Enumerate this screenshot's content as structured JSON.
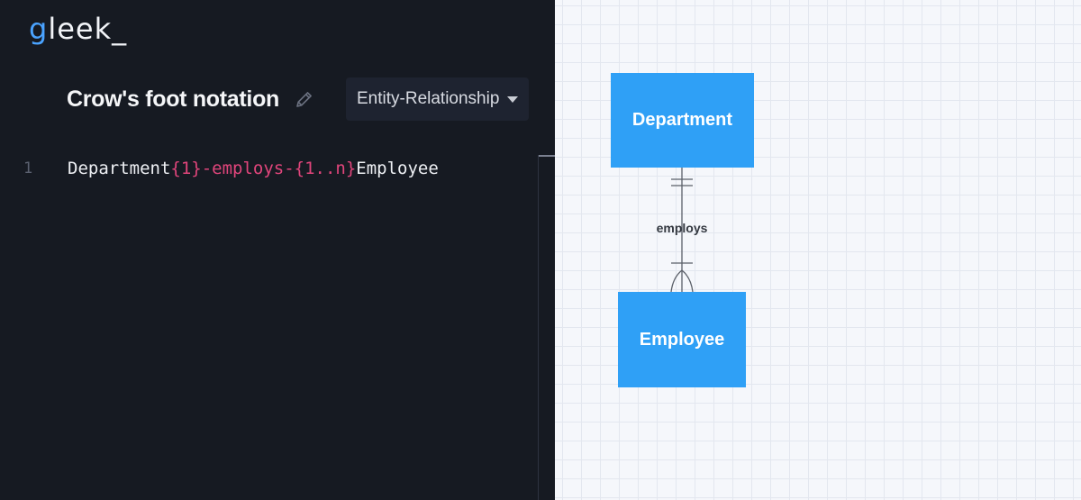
{
  "app": {
    "logo_first": "g",
    "logo_rest": "leek",
    "logo_cursor": "_",
    "logo_color": "#4aa3ff"
  },
  "editor": {
    "title": "Crow's foot notation",
    "edit_icon": "pencil-icon",
    "diagram_type": "Entity-Relationship",
    "dropdown_icon": "caret-down-icon",
    "lines": [
      {
        "number": "1",
        "tokens": {
          "entity_a": "Department",
          "relation": "{1}-employs-{1..n}",
          "entity_b": "Employee"
        }
      }
    ],
    "colors": {
      "background": "#161a22",
      "relation_token": "#e0457b"
    }
  },
  "diagram": {
    "entities": {
      "department": "Department",
      "employee": "Employee"
    },
    "relationship": {
      "label": "employs",
      "from_cardinality": "one-and-only-one",
      "to_cardinality": "one-or-many"
    },
    "colors": {
      "entity_fill": "#2fa0f6",
      "connector": "#5a5f68"
    }
  }
}
